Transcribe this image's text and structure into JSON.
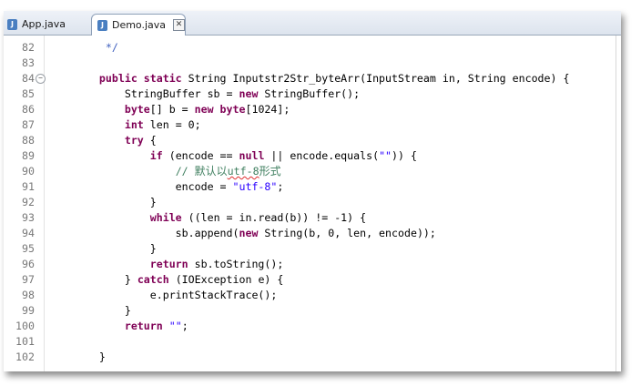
{
  "tabs": [
    {
      "label": "App.java",
      "icon": "java-file-icon",
      "active": false
    },
    {
      "label": "Demo.java",
      "icon": "java-file-icon",
      "active": true
    }
  ],
  "close_glyph": "✕",
  "fold_glyph": "−",
  "lines": [
    {
      "num": "82",
      "tokens": [
        [
          "jd",
          "     */"
        ]
      ]
    },
    {
      "num": "83",
      "tokens": []
    },
    {
      "num": "84",
      "fold": true,
      "tokens": [
        [
          "t",
          "    "
        ],
        [
          "kw",
          "public static"
        ],
        [
          "t",
          " String Inputstr2Str_byteArr(InputStream in, String encode) {"
        ]
      ]
    },
    {
      "num": "85",
      "tokens": [
        [
          "t",
          "        StringBuffer sb = "
        ],
        [
          "kw",
          "new"
        ],
        [
          "t",
          " StringBuffer();"
        ]
      ]
    },
    {
      "num": "86",
      "tokens": [
        [
          "t",
          "        "
        ],
        [
          "kw",
          "byte"
        ],
        [
          "t",
          "[] b = "
        ],
        [
          "kw",
          "new byte"
        ],
        [
          "t",
          "[1024];"
        ]
      ]
    },
    {
      "num": "87",
      "tokens": [
        [
          "t",
          "        "
        ],
        [
          "kw",
          "int"
        ],
        [
          "t",
          " len = 0;"
        ]
      ]
    },
    {
      "num": "88",
      "tokens": [
        [
          "t",
          "        "
        ],
        [
          "kw",
          "try"
        ],
        [
          "t",
          " {"
        ]
      ]
    },
    {
      "num": "89",
      "tokens": [
        [
          "t",
          "            "
        ],
        [
          "kw",
          "if"
        ],
        [
          "t",
          " (encode == "
        ],
        [
          "kw",
          "null"
        ],
        [
          "t",
          " || encode.equals("
        ],
        [
          "str",
          "\"\""
        ],
        [
          "t",
          ")) {"
        ]
      ]
    },
    {
      "num": "90",
      "tokens": [
        [
          "t",
          "                "
        ],
        [
          "cmt",
          "// "
        ],
        [
          "cmtcn",
          "默认以"
        ],
        [
          "cmtsq",
          "utf-8"
        ],
        [
          "cmtcn",
          "形式"
        ]
      ]
    },
    {
      "num": "91",
      "tokens": [
        [
          "t",
          "                encode = "
        ],
        [
          "str",
          "\"utf-8\""
        ],
        [
          "t",
          ";"
        ]
      ]
    },
    {
      "num": "92",
      "tokens": [
        [
          "t",
          "            }"
        ]
      ]
    },
    {
      "num": "93",
      "tokens": [
        [
          "t",
          "            "
        ],
        [
          "kw",
          "while"
        ],
        [
          "t",
          " ((len = in.read(b)) != -1) {"
        ]
      ]
    },
    {
      "num": "94",
      "tokens": [
        [
          "t",
          "                sb.append("
        ],
        [
          "kw",
          "new"
        ],
        [
          "t",
          " String(b, 0, len, encode));"
        ]
      ]
    },
    {
      "num": "95",
      "tokens": [
        [
          "t",
          "            }"
        ]
      ]
    },
    {
      "num": "96",
      "tokens": [
        [
          "t",
          "            "
        ],
        [
          "kw",
          "return"
        ],
        [
          "t",
          " sb.toString();"
        ]
      ]
    },
    {
      "num": "97",
      "tokens": [
        [
          "t",
          "        } "
        ],
        [
          "kw",
          "catch"
        ],
        [
          "t",
          " (IOException e) {"
        ]
      ]
    },
    {
      "num": "98",
      "tokens": [
        [
          "t",
          "            e.printStackTrace();"
        ]
      ]
    },
    {
      "num": "99",
      "tokens": [
        [
          "t",
          "        }"
        ]
      ]
    },
    {
      "num": "100",
      "tokens": [
        [
          "t",
          "        "
        ],
        [
          "kw",
          "return"
        ],
        [
          "t",
          " "
        ],
        [
          "str",
          "\"\""
        ],
        [
          "t",
          ";"
        ]
      ]
    },
    {
      "num": "101",
      "tokens": []
    },
    {
      "num": "102",
      "tokens": [
        [
          "t",
          "    }"
        ]
      ]
    }
  ]
}
